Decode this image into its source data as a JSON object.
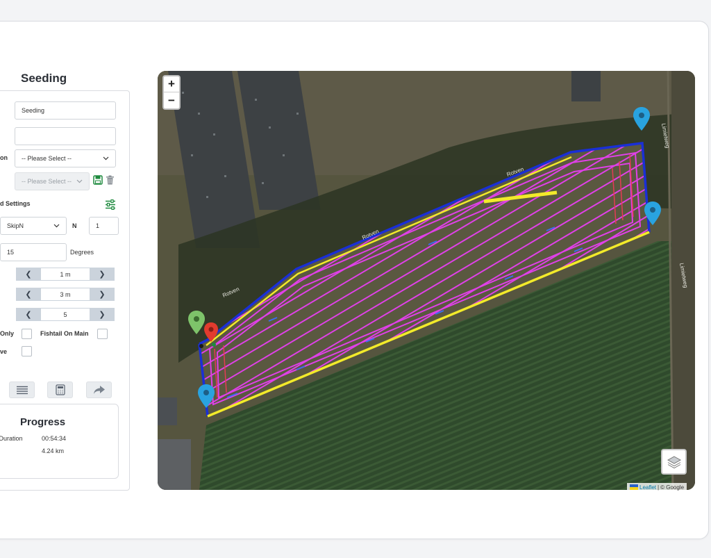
{
  "panel": {
    "title": "Seeding",
    "name_value": "Seeding",
    "select_placeholder": "-- Please Select --",
    "select_row_label": "on",
    "preset_placeholder": "-- Please Select --",
    "settings_heading": "d Settings",
    "pattern_value": "SkipN",
    "n_label": "N",
    "n_value": "1",
    "angle_value": "15",
    "angle_unit": "Degrees",
    "stepper1_value": "1 m",
    "stepper2_value": "3 m",
    "stepper3_value": "5",
    "check1_label": "Only",
    "check2_label": "Fishtail On Main",
    "check3_label": "ve"
  },
  "progress": {
    "title": "Progress",
    "duration_label": "d Duration",
    "duration_value": "00:54:34",
    "distance_value": "4.24 km"
  },
  "map": {
    "zoom_in": "+",
    "zoom_out": "−",
    "road_label": "Rotven",
    "side_road_label": "Limietweg",
    "attribution_leaflet": "Leaflet",
    "attribution_sep": "|",
    "attribution_copy": "© Google"
  },
  "colors": {
    "boundary": "#1a2fd6",
    "headland": "#f2ea2a",
    "paths": "#e040e8",
    "marker_blue": "#29a3e0",
    "marker_green": "#7ec36a",
    "marker_red": "#e23b2e",
    "save_green": "#1e8a3e"
  },
  "icons": [
    "sliders-icon",
    "chevron-down-icon",
    "save-icon",
    "trash-icon",
    "chevron-left-icon",
    "chevron-right-icon",
    "list-icon",
    "calculator-icon",
    "share-icon",
    "layers-icon",
    "map-marker-icon"
  ]
}
